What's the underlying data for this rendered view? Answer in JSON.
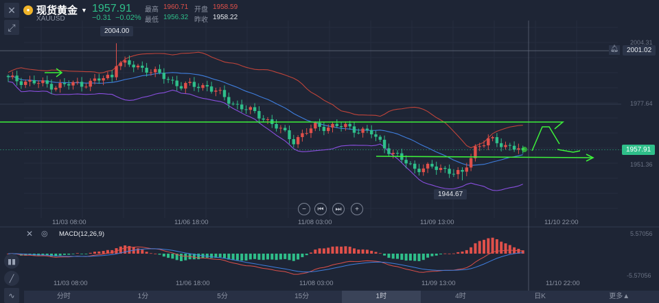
{
  "header": {
    "name": "现货黄金",
    "symbol": "XAUUSD",
    "price": "1957.91",
    "change": "−0.31",
    "change_pct": "−0.02%",
    "high_label": "最高",
    "high": "1960.71",
    "open_label": "开盘",
    "open": "1958.59",
    "low_label": "最低",
    "low": "1956.32",
    "prev_label": "昨收",
    "prev": "1958.22"
  },
  "toolbar": {
    "close_icon": "close-icon",
    "expand_icon": "expand-icon"
  },
  "main_chart": {
    "axis_labels": [
      "2004.31",
      "1977.64",
      "1951.36"
    ],
    "alert_price": "2001.02",
    "current_price": "1957.91",
    "high_marker": "2004.00",
    "low_marker": "1944.67",
    "time_labels": [
      "11/03 08:00",
      "11/06 18:00",
      "11/08 03:00",
      "11/09 13:00",
      "11/10 22:00"
    ],
    "price_keypoints": [
      [
        0,
        1988.6
      ],
      [
        6,
        1987
      ],
      [
        11,
        1985.6
      ],
      [
        19,
        1987
      ],
      [
        24,
        1990
      ],
      [
        25,
        1996
      ],
      [
        28,
        1994.5
      ],
      [
        32,
        1993
      ],
      [
        40,
        1985.6
      ],
      [
        46,
        1985.6
      ],
      [
        52,
        1978
      ],
      [
        59,
        1972
      ],
      [
        66,
        1962
      ],
      [
        71,
        1968
      ],
      [
        78,
        1968
      ],
      [
        84,
        1965
      ],
      [
        89,
        1956
      ],
      [
        94,
        1950
      ],
      [
        100,
        1950
      ],
      [
        105,
        1947
      ],
      [
        108,
        1959
      ],
      [
        111,
        1962
      ],
      [
        119,
        1957.91
      ]
    ],
    "colors": {
      "up": "#e0504a",
      "down": "#2fbf8a",
      "upper": "#c0443a",
      "middle": "#3f7fe0",
      "lower": "#8a4fe0",
      "annotation": "#3df23a"
    }
  },
  "macd": {
    "label": "MACD(12,26,9)",
    "max": "5.57056",
    "min": "-5.57056",
    "time_labels": [
      "11/03 08:00",
      "11/06 18:00",
      "11/08 03:00",
      "11/09 13:00",
      "11/10 22:00"
    ]
  },
  "tabs": [
    {
      "label": "分时"
    },
    {
      "label": "1分"
    },
    {
      "label": "5分"
    },
    {
      "label": "15分"
    },
    {
      "label": "1时",
      "active": true
    },
    {
      "label": "4时"
    },
    {
      "label": "日K"
    },
    {
      "label": "更多▲"
    }
  ]
}
